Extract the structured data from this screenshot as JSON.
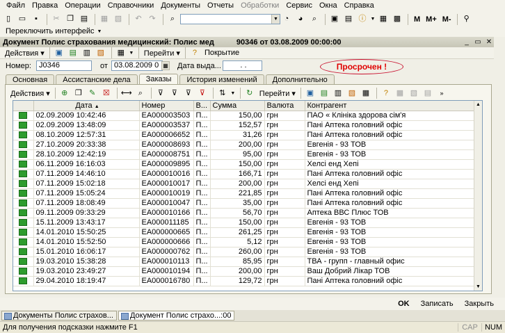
{
  "menu": [
    "Файл",
    "Правка",
    "Операции",
    "Справочники",
    "Документы",
    "Отчеты",
    "Обработки",
    "Сервис",
    "Окна",
    "Справка"
  ],
  "switch_interface": "Переключить интерфейс",
  "window": {
    "title": "Документ Полис страхования медицинский: Полис мед",
    "title_number": "90346 от 03.08.2009 00:00:00"
  },
  "doc_toolbar": {
    "actions": "Действия",
    "goto": "Перейти",
    "coverage": "Покрытие"
  },
  "fields": {
    "number_label": "Номер:",
    "number_value": "J0346",
    "from_label": "от",
    "date_value": "03.08.2009 0",
    "issue_label": "Дата выда...",
    "issue_value": ". ."
  },
  "status": {
    "text": "Просрочен !"
  },
  "tabs": [
    "Основная",
    "Ассистанские дела",
    "Заказы",
    "История изменений",
    "Дополнительно"
  ],
  "table_toolbar": {
    "actions": "Действия",
    "goto": "Перейти"
  },
  "table": {
    "columns": [
      "",
      "Дата",
      "Номер",
      "В...",
      "Сумма",
      "Валюта",
      "Контрагент"
    ],
    "rows": [
      {
        "date": "02.09.2009 10:42:46",
        "number": "ЕА000003503",
        "v": "П...",
        "sum": "150,00",
        "cur": "грн",
        "agent": "ПАО « Клініка здорова сім'я"
      },
      {
        "date": "02.09.2009 13:48:09",
        "number": "ЕА000003537",
        "v": "П...",
        "sum": "152,57",
        "cur": "грн",
        "agent": "Пані Аптека головний офіс"
      },
      {
        "date": "08.10.2009 12:57:31",
        "number": "ЕА000006652",
        "v": "П...",
        "sum": "31,26",
        "cur": "грн",
        "agent": "Пані Аптека головний офіс"
      },
      {
        "date": "27.10.2009 20:33:38",
        "number": "ЕА000008693",
        "v": "П...",
        "sum": "200,00",
        "cur": "грн",
        "agent": "Евгенія - 93 ТОВ"
      },
      {
        "date": "28.10.2009 12:42:19",
        "number": "ЕА000008751",
        "v": "П...",
        "sum": "95,00",
        "cur": "грн",
        "agent": "Евгенія - 93 ТОВ"
      },
      {
        "date": "06.11.2009 16:16:03",
        "number": "ЕА000009895",
        "v": "П...",
        "sum": "150,00",
        "cur": "грн",
        "agent": "Хелсі енд Хепі"
      },
      {
        "date": "07.11.2009 14:46:10",
        "number": "ЕА000010016",
        "v": "П...",
        "sum": "166,71",
        "cur": "грн",
        "agent": "Пані Аптека головний офіс"
      },
      {
        "date": "07.11.2009 15:02:18",
        "number": "ЕА000010017",
        "v": "П...",
        "sum": "200,00",
        "cur": "грн",
        "agent": "Хелсі енд Хепі"
      },
      {
        "date": "07.11.2009 15:05:24",
        "number": "ЕА000010019",
        "v": "П...",
        "sum": "221,85",
        "cur": "грн",
        "agent": "Пані Аптека головний офіс"
      },
      {
        "date": "07.11.2009 18:08:49",
        "number": "ЕА000010047",
        "v": "П...",
        "sum": "35,00",
        "cur": "грн",
        "agent": "Пані Аптека головний офіс"
      },
      {
        "date": "09.11.2009 09:33:29",
        "number": "ЕА000010166",
        "v": "П...",
        "sum": "56,70",
        "cur": "грн",
        "agent": "Аптека ВВС Плюс ТОВ"
      },
      {
        "date": "15.11.2009 13:43:17",
        "number": "ЕА000011185",
        "v": "П...",
        "sum": "150,00",
        "cur": "грн",
        "agent": "Евгенія - 93 ТОВ"
      },
      {
        "date": "14.01.2010 15:50:25",
        "number": "ЕА000000665",
        "v": "П...",
        "sum": "261,25",
        "cur": "грн",
        "agent": "Евгенія - 93 ТОВ"
      },
      {
        "date": "14.01.2010 15:52:50",
        "number": "ЕА000000666",
        "v": "П...",
        "sum": "5,12",
        "cur": "грн",
        "agent": "Евгенія - 93 ТОВ"
      },
      {
        "date": "15.01.2010 16:06:17",
        "number": "ЕА000000762",
        "v": "П...",
        "sum": "260,00",
        "cur": "грн",
        "agent": "Евгенія - 93 ТОВ"
      },
      {
        "date": "19.03.2010 15:38:28",
        "number": "ЕА000010113",
        "v": "П...",
        "sum": "85,95",
        "cur": "грн",
        "agent": "ТВА - групп - главный офис"
      },
      {
        "date": "19.03.2010 23:49:27",
        "number": "ЕА000010194",
        "v": "П...",
        "sum": "200,00",
        "cur": "грн",
        "agent": "Ваш Добрий Лікар ТОВ"
      },
      {
        "date": "29.04.2010 18:19:47",
        "number": "ЕА000016780",
        "v": "П...",
        "sum": "129,72",
        "cur": "грн",
        "agent": "Пані Аптека головний офіс"
      }
    ]
  },
  "bottom_buttons": {
    "ok": "OK",
    "save": "Записать",
    "close": "Закрыть"
  },
  "taskbar": [
    "Документы Полис страхов...",
    "Документ Полис страхо...:00"
  ],
  "statusbar": {
    "hint": "Для получения подсказки нажмите F1",
    "cap": "CAP",
    "num": "NUM"
  },
  "icons": {
    "row": "document-posted-icon"
  }
}
